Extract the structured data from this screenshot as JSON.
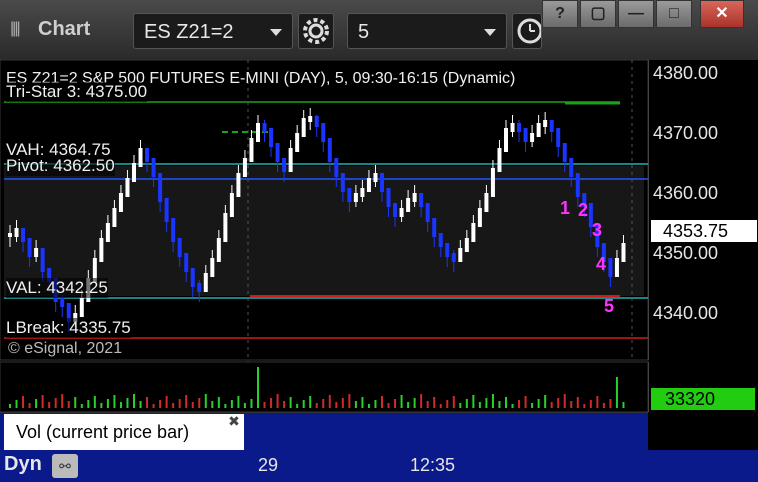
{
  "window": {
    "title": "Chart",
    "symbol": "ES Z21=2",
    "interval": "5",
    "buttons": [
      "?",
      "▢",
      "—",
      "□",
      "✕"
    ]
  },
  "header": {
    "symbol_line": "ES Z21=2 S&P 500 FUTURES E-MINI (DAY), 5, 09:30-16:15 (Dynamic)"
  },
  "study_labels": {
    "tristar": "Tri-Star 3: 4375.00",
    "vah": "VAH: 4364.75",
    "pivot": "Pivot: 4362.50",
    "val": "VAL: 4342.25",
    "lbreak": "LBreak: 4335.75"
  },
  "watermark": "© eSignal, 2021",
  "price_axis": {
    "labels": [
      "4380.00",
      "4370.00",
      "4360.00",
      "4350.00",
      "4340.00"
    ],
    "current_price": "4353.75"
  },
  "volume": {
    "legend": "Vol (current price bar)",
    "current": "33320",
    "close_glyph": "✖"
  },
  "bottom": {
    "mode": "Dyn",
    "time_labels": [
      "29",
      "12:35"
    ]
  },
  "markers": [
    "1",
    "2",
    "3",
    "4",
    "5"
  ],
  "colors": {
    "up_bar": "#ffffff",
    "down_bar": "#1a35ff",
    "marker": "#ff33ff",
    "tristar_line": "#1aa01a",
    "pivot_line": "#2255ff",
    "vah_line": "#20b0b0",
    "lbreak_line": "#d01a1a",
    "volume_current": "#22cc11"
  }
}
